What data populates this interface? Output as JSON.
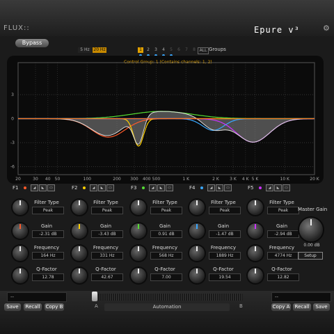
{
  "header": {
    "logo": "FLUX::",
    "title": "Epure v³",
    "settings_icon": "gear-icon"
  },
  "toolbar": {
    "bypass_label": "Bypass",
    "hz_options": [
      "5 Hz",
      "20 Hz"
    ],
    "hz_selected": "20 Hz",
    "control_groups": [
      "1",
      "2",
      "3",
      "4",
      "5",
      "6",
      "7",
      "8"
    ],
    "all_label": "ALL",
    "groups_label": "Groups",
    "control_group_text": "Control Group: 1 (Contains channels: 1, 2)"
  },
  "graph": {
    "y_labels": [
      "3",
      "0",
      "-3",
      "-6"
    ],
    "x_labels": [
      "20",
      "30",
      "40",
      "50",
      "100",
      "200",
      "300",
      "400",
      "500",
      "1 K",
      "2 K",
      "3 K",
      "4 K",
      "5 K",
      "10 K",
      "20 K"
    ]
  },
  "bands": [
    {
      "name": "F1",
      "color": "#ff5a2a",
      "filter_type_label": "Filter Type",
      "filter_type": "Peak",
      "gain_label": "Gain",
      "gain": "-2.31 dB",
      "freq_label": "Frequency",
      "freq": "164 Hz",
      "q_label": "Q-Factor",
      "q": "12.78"
    },
    {
      "name": "F2",
      "color": "#ffd000",
      "filter_type_label": "Filter Type",
      "filter_type": "Peak",
      "gain_label": "Gain",
      "gain": "-3.43 dB",
      "freq_label": "Frequency",
      "freq": "331 Hz",
      "q_label": "Q-Factor",
      "q": "42.67"
    },
    {
      "name": "F3",
      "color": "#55dd33",
      "filter_type_label": "Filter Type",
      "filter_type": "Peak",
      "gain_label": "Gain",
      "gain": "0.91 dB",
      "freq_label": "Frequency",
      "freq": "568 Hz",
      "q_label": "Q-Factor",
      "q": "7.00"
    },
    {
      "name": "F4",
      "color": "#3aa8ff",
      "filter_type_label": "Filter Type",
      "filter_type": "Peak",
      "gain_label": "Gain",
      "gain": "-1.47 dB",
      "freq_label": "Frequency",
      "freq": "1889 Hz",
      "q_label": "Q-Factor",
      "q": "19.54"
    },
    {
      "name": "F5",
      "color": "#cc33ff",
      "filter_type_label": "Filter Type",
      "filter_type": "Peak",
      "gain_label": "Gain",
      "gain": "-2.94 dB",
      "freq_label": "Frequency",
      "freq": "4774 Hz",
      "q_label": "Q-Factor",
      "q": "12.82"
    }
  ],
  "master": {
    "label": "Master Gain",
    "value": "0.00 dB",
    "setup_label": "Setup"
  },
  "footer": {
    "preset_left": "--",
    "preset_right": "--",
    "save_a": "Save",
    "recall_a": "Recall",
    "copy_b": "Copy B",
    "copy_a": "Copy A",
    "recall_b": "Recall",
    "save_b": "Save",
    "a_label": "A",
    "b_label": "B",
    "automation_label": "Automation"
  }
}
